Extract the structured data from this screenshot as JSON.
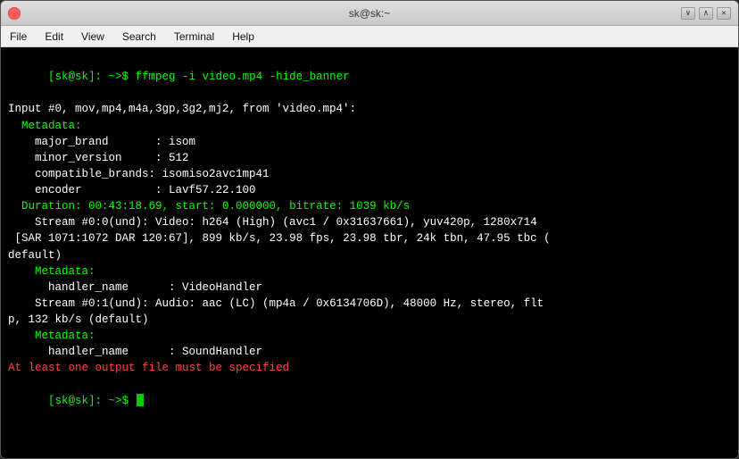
{
  "window": {
    "title": "sk@sk:~",
    "controls": {
      "close": "×",
      "minimize": "−",
      "maximize": "+"
    },
    "right_buttons": [
      "∨",
      "∧",
      "✕"
    ]
  },
  "menubar": {
    "items": [
      "File",
      "Edit",
      "View",
      "Search",
      "Terminal",
      "Help"
    ]
  },
  "terminal": {
    "lines": [
      {
        "type": "prompt_command",
        "prompt": "[sk@sk]: ~>$ ",
        "command": "ffmpeg -i video.mp4 -hide_banner"
      },
      {
        "type": "white",
        "text": "Input #0, mov,mp4,m4a,3gp,3g2,mj2, from 'video.mp4':"
      },
      {
        "type": "green",
        "text": "  Metadata:"
      },
      {
        "type": "white",
        "text": "    major_brand       : isom"
      },
      {
        "type": "white",
        "text": "    minor_version      : 512"
      },
      {
        "type": "white",
        "text": "    compatible_brands: isomiso2avc1mp41"
      },
      {
        "type": "white",
        "text": "    encoder           : Lavf57.22.100"
      },
      {
        "type": "green",
        "text": "  Duration: 00:43:18.69, start: 0.000000, bitrate: 1039 kb/s"
      },
      {
        "type": "white",
        "text": "    Stream #0:0(und): Video: h264 (High) (avc1 / 0x31637661), yuv420p, 1280x714"
      },
      {
        "type": "white",
        "text": " [SAR 1071:1072 DAR 120:67], 899 kb/s, 23.98 fps, 23.98 tbr, 24k tbn, 47.95 tbc ("
      },
      {
        "type": "white",
        "text": "default)"
      },
      {
        "type": "green",
        "text": "    Metadata:"
      },
      {
        "type": "white",
        "text": "      handler_name      : VideoHandler"
      },
      {
        "type": "white",
        "text": "    Stream #0:1(und): Audio: aac (LC) (mp4a / 0x6134706D), 48000 Hz, stereo, flt"
      },
      {
        "type": "white",
        "text": "p, 132 kb/s (default)"
      },
      {
        "type": "green",
        "text": "    Metadata:"
      },
      {
        "type": "white",
        "text": "      handler_name      : SoundHandler"
      },
      {
        "type": "red",
        "text": "At least one output file must be specified"
      },
      {
        "type": "prompt_only",
        "prompt": "[sk@sk]: ~>$ "
      }
    ]
  }
}
